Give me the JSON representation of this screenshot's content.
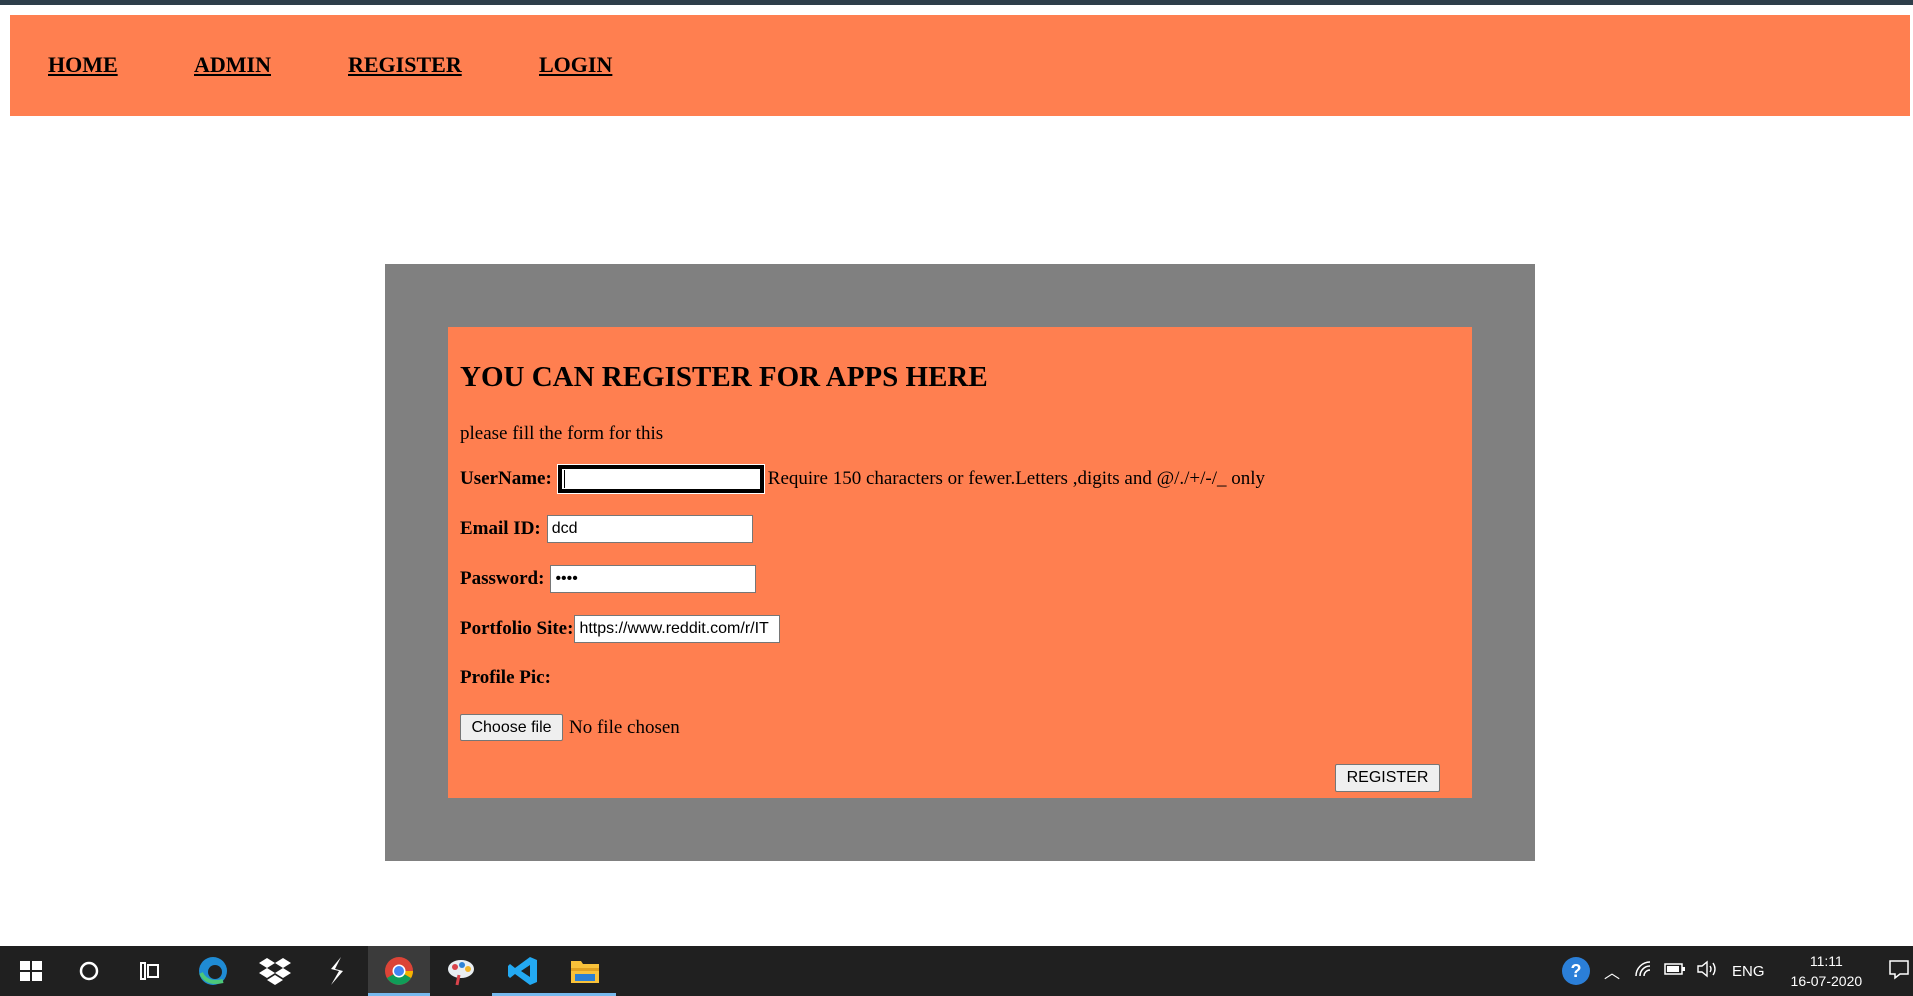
{
  "nav": {
    "items": [
      "HOME",
      "ADMIN",
      "REGISTER",
      "LOGIN"
    ]
  },
  "form": {
    "title": "YOU CAN REGISTER FOR APPS HERE",
    "subtitle": "please fill the form for this",
    "username_label": "UserName:",
    "username_value": "",
    "username_help": "Require 150 characters or fewer.Letters ,digits and @/./+/-/_ only",
    "email_label": "Email ID:",
    "email_value": "dcd",
    "password_label": "Password:",
    "password_masked": "••••",
    "portfolio_label": "Portfolio Site:",
    "portfolio_value": "https://www.reddit.com/r/IT",
    "profile_pic_label": "Profile Pic:",
    "choose_file_label": "Choose file",
    "no_file_text": "No file chosen",
    "register_button": "REGISTER"
  },
  "taskbar": {
    "icons": [
      "windows-start-icon",
      "search-circle-icon",
      "task-view-icon",
      "edge-icon",
      "dropbox-icon",
      "sublime-icon",
      "chrome-icon",
      "paint-icon",
      "vscode-icon",
      "file-explorer-icon"
    ],
    "active": "chrome-icon",
    "language": "ENG",
    "time": "11:11",
    "date": "16-07-2020"
  },
  "colors": {
    "accent": "#ff7f50",
    "panel": "#808080",
    "taskbar": "#202020"
  }
}
